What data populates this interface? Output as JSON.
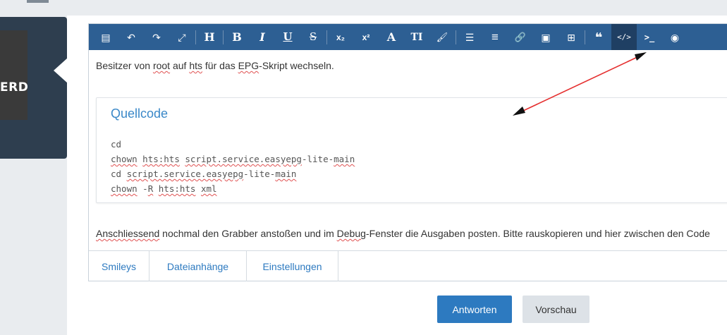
{
  "sidebar": {
    "badge_text": "ERD"
  },
  "toolbar": {
    "buttons": [
      {
        "name": "source-view",
        "glyph": "▤"
      },
      {
        "name": "undo",
        "glyph": "↶"
      },
      {
        "name": "redo",
        "glyph": "↷"
      },
      {
        "name": "fullscreen",
        "glyph": "⤢"
      },
      {
        "name": "heading",
        "glyph": "H"
      },
      {
        "name": "bold",
        "glyph": "B"
      },
      {
        "name": "italic",
        "glyph": "I"
      },
      {
        "name": "underline",
        "glyph": "U"
      },
      {
        "name": "strikethrough",
        "glyph": "S"
      },
      {
        "name": "subscript",
        "glyph": "x₂"
      },
      {
        "name": "superscript",
        "glyph": "x²"
      },
      {
        "name": "font",
        "glyph": "A"
      },
      {
        "name": "font-size",
        "glyph": "TI"
      },
      {
        "name": "color",
        "glyph": "🖌"
      },
      {
        "name": "list",
        "glyph": "☰"
      },
      {
        "name": "align",
        "glyph": "≡"
      },
      {
        "name": "link",
        "glyph": "🔗"
      },
      {
        "name": "image",
        "glyph": "▣"
      },
      {
        "name": "table",
        "glyph": "⊞"
      },
      {
        "name": "quote",
        "glyph": "❝"
      },
      {
        "name": "code",
        "glyph": "</>"
      },
      {
        "name": "inline-code",
        "glyph": ">_"
      },
      {
        "name": "spoiler",
        "glyph": "◉"
      }
    ]
  },
  "content": {
    "line1": {
      "t1": "Besitzer von ",
      "w1": "root",
      "t2": " auf ",
      "w2": "hts",
      "t3": " für das ",
      "w3": "EPG",
      "t4": "-Skript wechseln."
    },
    "code": {
      "title": "Quellcode",
      "l1": "cd",
      "l2a": "chown",
      "l2b": " ",
      "l2c": "hts:hts",
      "l2d": " ",
      "l2e": "script.service.easyepg",
      "l2f": "-lite-",
      "l2g": "main",
      "l3a": "cd ",
      "l3b": "script.service.easyepg",
      "l3c": "-lite-",
      "l3d": "main",
      "l4a": "chown",
      "l4b": " -",
      "l4c": "R",
      "l4d": " ",
      "l4e": "hts:hts",
      "l4f": " ",
      "l4g": "xml"
    },
    "line2": {
      "w1": "Anschliessend",
      "t1": " nochmal den Grabber anstoßen und im ",
      "w2": "Debug",
      "t2": "-Fenster die Ausgaben posten. Bitte rauskopieren und hier zwischen den Code"
    }
  },
  "tabs": [
    "Smileys",
    "Dateianhänge",
    "Einstellungen"
  ],
  "actions": {
    "submit": "Antworten",
    "preview": "Vorschau"
  },
  "colors": {
    "toolbar": "#2d5f93",
    "toolbar_active": "#1f3f63",
    "accent": "#2d7ac0",
    "annotation_arrow": "#e53030",
    "sidebar": "#2e3e4f"
  }
}
